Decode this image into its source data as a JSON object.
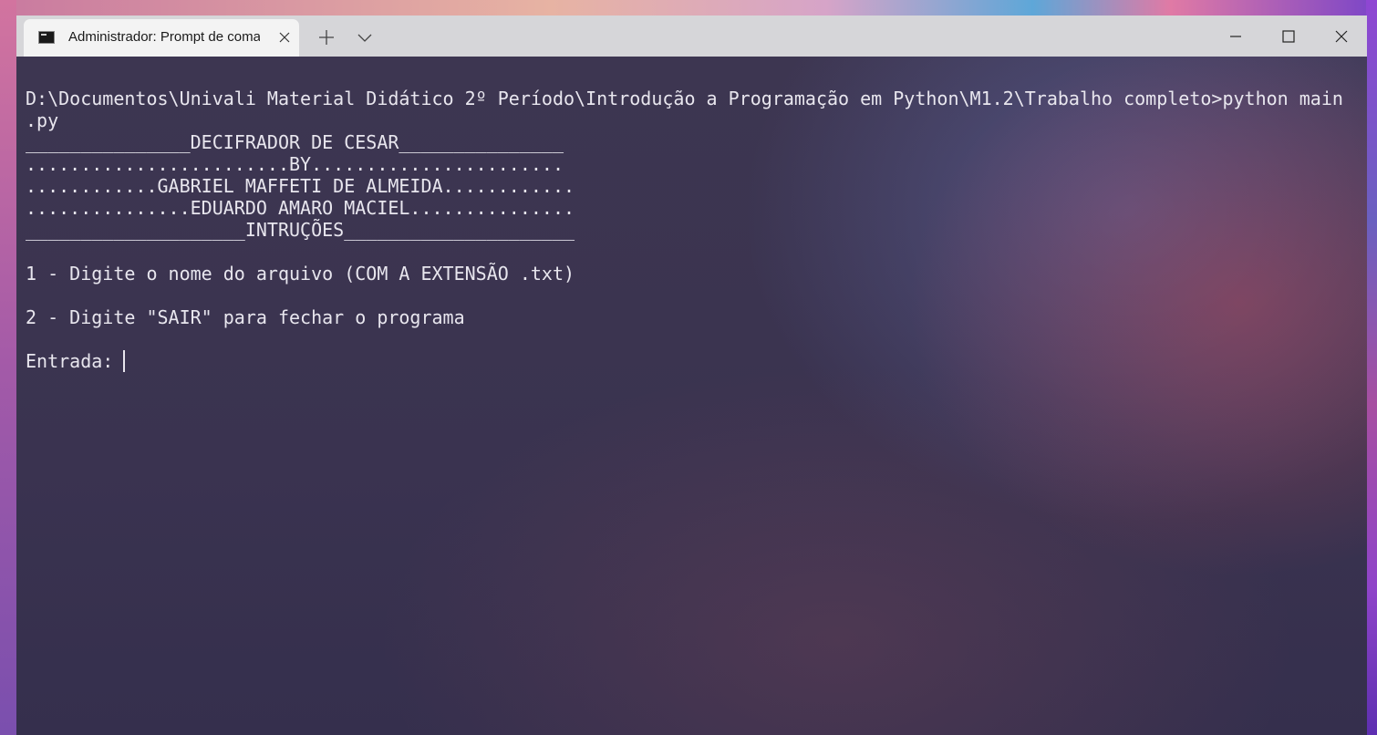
{
  "tab": {
    "title": "Administrador: Prompt de coma",
    "icon": "cmd-icon"
  },
  "window_controls": {
    "minimize_icon": "minimize-icon",
    "maximize_icon": "maximize-icon",
    "close_icon": "close-icon"
  },
  "terminal": {
    "path_line": "D:\\Documentos\\Univali Material Didático 2º Período\\Introdução a Programação em Python\\M1.2\\Trabalho completo>python main",
    "path_line_wrap": ".py",
    "header_line": "_______________DECIFRADOR DE CESAR_______________",
    "by_line": "........................BY.......................",
    "author1_line": "............GABRIEL MAFFETI DE ALMEIDA............",
    "author2_line": "...............EDUARDO AMARO MACIEL...............",
    "instructions_line": "____________________INTRUÇÕES_____________________",
    "instruction_1": "1 - Digite o nome do arquivo (COM A EXTENSÃO .txt)",
    "instruction_2": "2 - Digite \"SAIR\" para fechar o programa",
    "input_prompt": "Entrada: "
  },
  "colors": {
    "terminal_text": "#e8e6ee",
    "titlebar": "#d6d6d9",
    "tab_active": "#f3f3f3"
  }
}
